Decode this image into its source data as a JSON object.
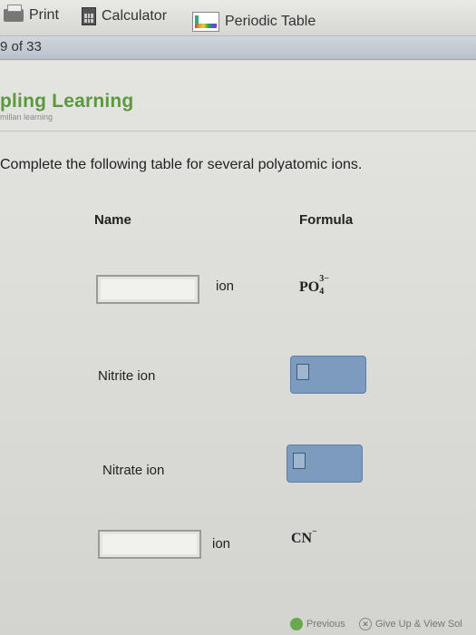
{
  "toolbar": {
    "print_label": "Print",
    "calculator_label": "Calculator",
    "periodic_label": "Periodic Table"
  },
  "pagebar": {
    "page_text": "9 of 33"
  },
  "brand": {
    "name": "pling Learning",
    "subtitle": "millan learning"
  },
  "question": {
    "instruction": "Complete the following table for several polyatomic ions.",
    "headers": {
      "name": "Name",
      "formula": "Formula"
    },
    "rows": [
      {
        "suffix": "ion",
        "formula_main": "PO",
        "formula_sub": "4",
        "formula_sup": "3−"
      },
      {
        "name": "Nitrite ion"
      },
      {
        "name": "Nitrate ion"
      },
      {
        "suffix": "ion",
        "formula_main": "CN",
        "formula_sup": "−"
      }
    ]
  },
  "footer": {
    "previous_label": "Previous",
    "giveup_label": "Give Up & View Sol"
  },
  "colors": {
    "brand_green": "#5a9a3c",
    "formula_box": "#7d9cbd"
  }
}
